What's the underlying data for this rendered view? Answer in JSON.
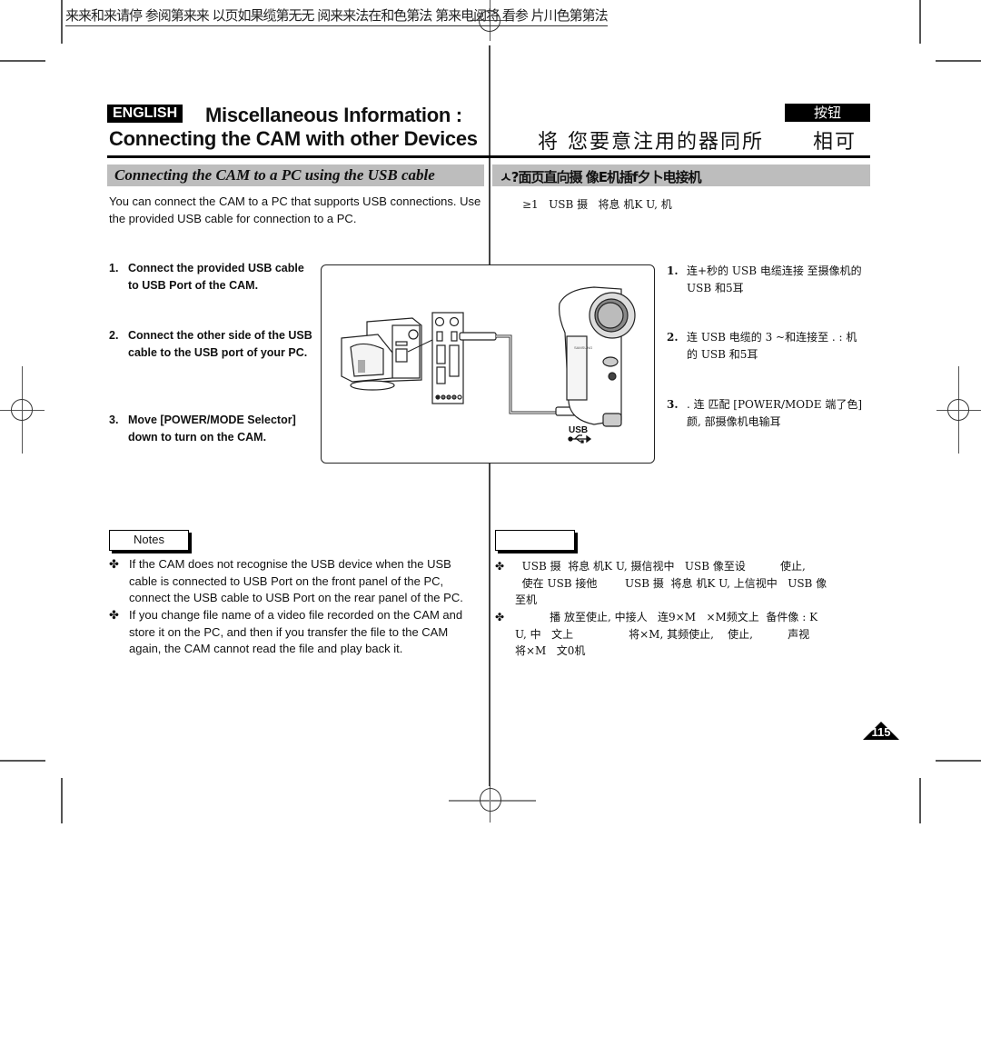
{
  "header_garbled": "来来和来请停 参阅第来来 以页如果缆第无无 阅来来法在和色第法 第来电阅将 看参 片川色第第法",
  "english_badge": "ENGLISH",
  "title": {
    "line1": "Miscellaneous Information :",
    "line2": "Connecting the CAM with other Devices"
  },
  "cn_badge": "按钮",
  "cn_title": "将 您要意注用的器同所      相可",
  "section": {
    "en": "Connecting the CAM to a PC using the USB cable",
    "cn": "ㅅ?面页直向摄  像E机插f夕卜电接机"
  },
  "intro": {
    "en": "You can connect the CAM to a PC that supports USB connections. Use the provided USB cable for connection to a PC.",
    "cn": "≥1   USB 摄   将息 机K U, 机"
  },
  "steps_en": [
    {
      "num": "1.",
      "text": "Connect the provided USB cable to USB Port of the CAM."
    },
    {
      "num": "2.",
      "text": "Connect the other side of the USB cable to the USB port of your PC."
    },
    {
      "num": "3.",
      "text": "Move [POWER/MODE Selector] down to turn on the CAM."
    }
  ],
  "steps_cn": [
    {
      "num": "1.",
      "text": "连+秒的 USB 电缆连接 至摄像机的 USB 和5耳"
    },
    {
      "num": "2.",
      "text": "连 USB 电缆的 3 ~和连接至 . : 机的 USB 和5耳"
    },
    {
      "num": "3.",
      "text": ". 连 匹配 [POWER/MODE 端了色] 颜, 部摄像机电输耳"
    }
  ],
  "figure": {
    "usb_label": "USB",
    "brand_label": "SAMSUNG"
  },
  "notes": {
    "label_en": "Notes",
    "label_cn": "",
    "bullet": "✤",
    "en": [
      "If the CAM does not recognise the USB device when the USB cable is connected to USB Port on the front panel of the PC, connect the USB cable to USB Port on the rear panel of the PC.",
      "If you change file name of a video file recorded on the CAM and store it on the PC, and then if you transfer the file to the CAM again, the CAM cannot read the file and play back it."
    ],
    "cn": [
      "  USB 摄  将息 机K U, 摄信视中   USB 像至设          使止,\n  使在 USB 接他        USB 摄  将息 机K U, 上信视中   USB 像\n至机",
      "          播 放至使止, 中接人   连9×M   ×M频文上  备件像 : K\nU, 中   文上                将×M, 其频使止,    使止,          声视\n将×M   文0机"
    ]
  },
  "page_number": "115"
}
